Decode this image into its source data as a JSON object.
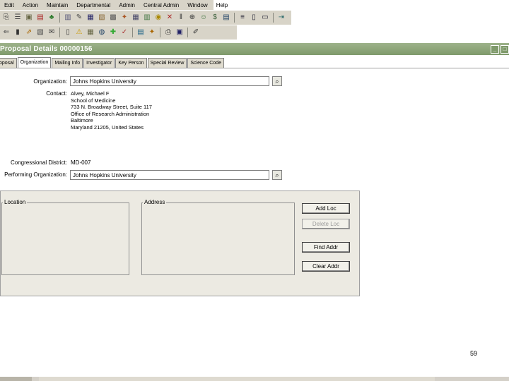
{
  "menu": [
    "Edit",
    "Action",
    "Maintain",
    "Departmental",
    "Admin",
    "Central Admin",
    "Window",
    "Help"
  ],
  "toolbar_row1_icons": [
    "new-icon",
    "open-icon",
    "copy-icon",
    "print-icon",
    "tree-icon",
    "chart-icon",
    "edit-icon",
    "save-disk-icon",
    "doc-icon",
    "calc-icon",
    "tools-icon",
    "grid-icon",
    "chart2-icon",
    "coins-icon",
    "rates-icon",
    "pause-icon",
    "dial-icon",
    "people-icon",
    "budget-icon",
    "folder-icon",
    "lines-icon",
    "columns-icon",
    "window-icon",
    "exit-icon"
  ],
  "toolbar_row2_icons": [
    "back-icon",
    "copy2-icon",
    "mail-icon",
    "doc2-icon",
    "alert-icon",
    "building-icon",
    "globe-icon",
    "green-icon",
    "check-icon",
    "tools2-icon",
    "cabinet-icon",
    "print2-icon",
    "save2-icon",
    "edit2-icon"
  ],
  "window": {
    "title": "Proposal Details   00000156"
  },
  "tabs": [
    "Proposal",
    "Organization",
    "Mailing Info",
    "Investigator",
    "Key Person",
    "Special Review",
    "Science Code"
  ],
  "form": {
    "organization_label": "Organization:",
    "organization_value": "Johns Hopkins University",
    "contact_label": "Contact:",
    "contact_lines": [
      "Alvey, Michael F",
      "School of Medicine",
      "733 N. Broadway Street, Suite 117",
      "Office of Research Administration",
      "Baltimore",
      "Maryland 21205, United States"
    ],
    "congressional_label": "Congressional District:",
    "congressional_value": "MD-007",
    "performing_label": "Performing Organization:",
    "performing_value": "Johns Hopkins University"
  },
  "panel": {
    "location_label": "Location",
    "address_label": "Address",
    "buttons": [
      "Add Loc",
      "Delete Loc",
      "Find Addr",
      "Clear Addr"
    ]
  },
  "page_number": "59"
}
